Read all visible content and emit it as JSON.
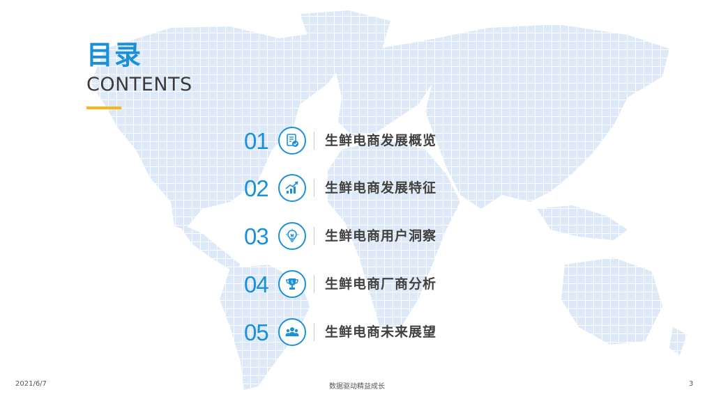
{
  "header": {
    "title_cn": "目录",
    "title_en": "CONTENTS"
  },
  "toc": [
    {
      "number": "01",
      "label": "生鲜电商发展概览",
      "icon": "document-check-icon"
    },
    {
      "number": "02",
      "label": "生鲜电商发展特征",
      "icon": "growth-chart-icon"
    },
    {
      "number": "03",
      "label": "生鲜电商用户洞察",
      "icon": "lightbulb-icon"
    },
    {
      "number": "04",
      "label": "生鲜电商厂商分析",
      "icon": "trophy-icon"
    },
    {
      "number": "05",
      "label": "生鲜电商未来展望",
      "icon": "people-group-icon"
    }
  ],
  "footer": {
    "date": "2021/6/7",
    "center": "数据驱动精益成长",
    "page": "3"
  },
  "colors": {
    "accent": "#1a90d9",
    "bar": "#f5b818",
    "map": "#dbe9f7"
  }
}
